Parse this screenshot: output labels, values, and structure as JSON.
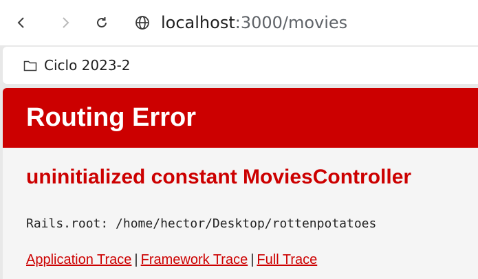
{
  "browser": {
    "url_host": "localhost",
    "url_rest": ":3000/movies",
    "icons": {
      "back": "back-icon",
      "forward": "forward-icon",
      "reload": "reload-icon",
      "site": "globe-icon"
    }
  },
  "bookmarks": [
    {
      "label": "Ciclo 2023-2",
      "icon": "folder-icon"
    }
  ],
  "page": {
    "title": "Routing Error",
    "message": "uninitialized constant MoviesController",
    "rails_root": "Rails.root: /home/hector/Desktop/rottenpotatoes",
    "links": {
      "application": "Application Trace",
      "framework": "Framework Trace",
      "full": "Full Trace",
      "separator": "|"
    },
    "colors": {
      "header": "#cc0000",
      "message": "#cc0000"
    }
  }
}
